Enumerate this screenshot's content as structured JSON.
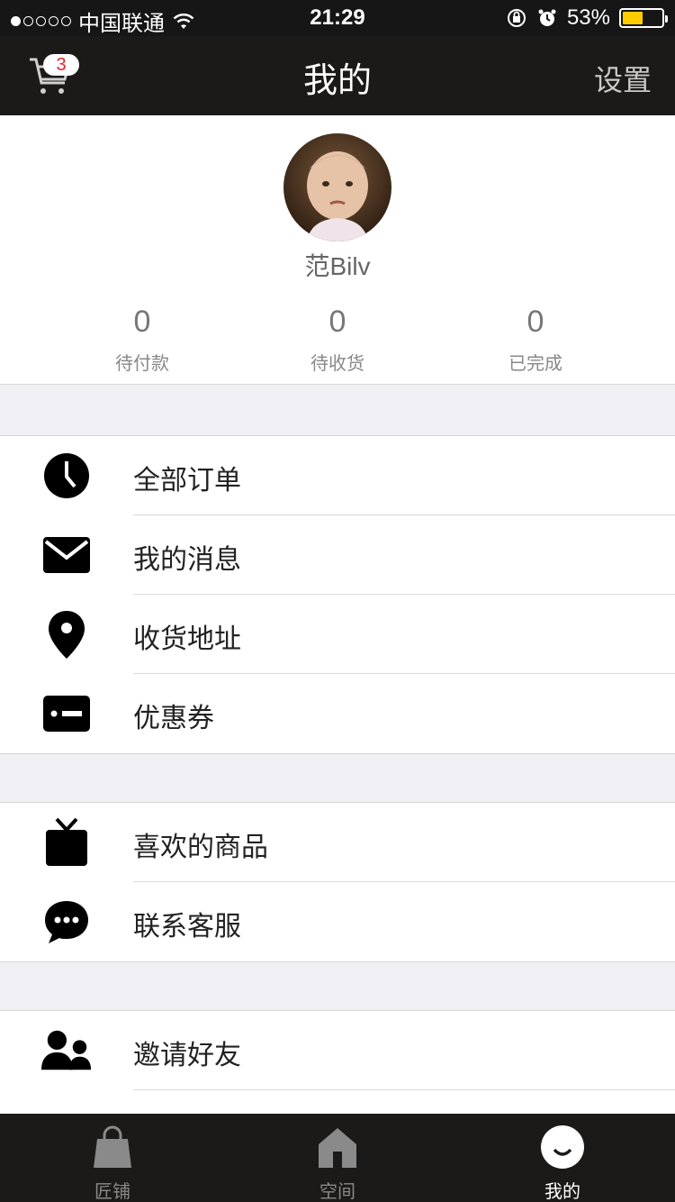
{
  "status_bar": {
    "carrier": "中国联通",
    "time": "21:29",
    "battery": "53%",
    "battery_level": 0.53
  },
  "nav": {
    "title": "我的",
    "right_label": "设置",
    "cart_badge": "3"
  },
  "profile": {
    "username": "范Bilv",
    "stats": [
      {
        "count": "0",
        "label": "待付款"
      },
      {
        "count": "0",
        "label": "待收货"
      },
      {
        "count": "0",
        "label": "已完成"
      }
    ]
  },
  "menu": {
    "group1": [
      {
        "label": "全部订单",
        "icon": "clock-icon"
      },
      {
        "label": "我的消息",
        "icon": "envelope-icon"
      },
      {
        "label": "收货地址",
        "icon": "location-pin-icon"
      },
      {
        "label": "优惠券",
        "icon": "coupon-icon"
      }
    ],
    "group2": [
      {
        "label": "喜欢的商品",
        "icon": "tv-icon"
      },
      {
        "label": "联系客服",
        "icon": "chat-bubble-icon"
      }
    ],
    "group3": [
      {
        "label": "邀请好友",
        "icon": "people-icon"
      }
    ]
  },
  "tabbar": {
    "tabs": [
      {
        "label": "匠铺"
      },
      {
        "label": "空间"
      },
      {
        "label": "我的"
      }
    ],
    "active_index": 2
  }
}
